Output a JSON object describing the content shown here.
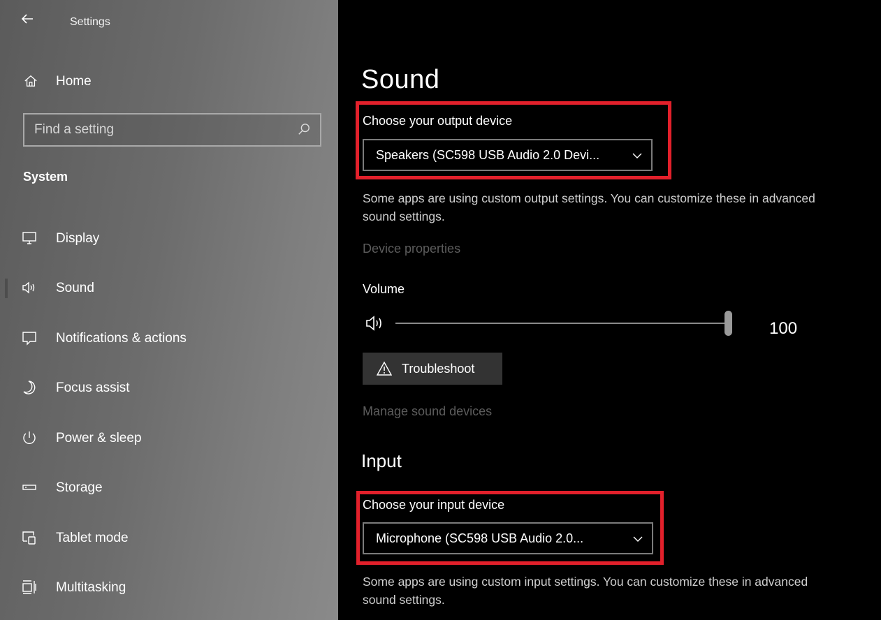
{
  "window": {
    "title": "Settings"
  },
  "sidebar": {
    "home_label": "Home",
    "search_placeholder": "Find a setting",
    "section": "System",
    "items": [
      {
        "label": "Display",
        "icon": "monitor-icon"
      },
      {
        "label": "Sound",
        "icon": "speaker-icon",
        "active": true
      },
      {
        "label": "Notifications & actions",
        "icon": "notification-icon"
      },
      {
        "label": "Focus assist",
        "icon": "moon-icon"
      },
      {
        "label": "Power & sleep",
        "icon": "power-icon"
      },
      {
        "label": "Storage",
        "icon": "storage-icon"
      },
      {
        "label": "Tablet mode",
        "icon": "tablet-mode-icon"
      },
      {
        "label": "Multitasking",
        "icon": "multitasking-icon"
      }
    ]
  },
  "main": {
    "title": "Sound",
    "output": {
      "label": "Choose your output device",
      "selected": "Speakers (SC598 USB Audio 2.0 Devi...",
      "info": "Some apps are using custom output settings. You can customize these in advanced sound settings.",
      "device_properties": "Device properties"
    },
    "volume": {
      "label": "Volume",
      "value": "100",
      "level": 1.0
    },
    "troubleshoot_label": "Troubleshoot",
    "manage_devices": "Manage sound devices",
    "input": {
      "header": "Input",
      "label": "Choose your input device",
      "selected": "Microphone (SC598 USB Audio 2.0...",
      "info": "Some apps are using custom input settings. You can customize these in advanced sound settings."
    }
  },
  "colors": {
    "highlight": "#e2202b",
    "sidebar_bg": "#6c6c6c",
    "main_bg": "#000000"
  }
}
